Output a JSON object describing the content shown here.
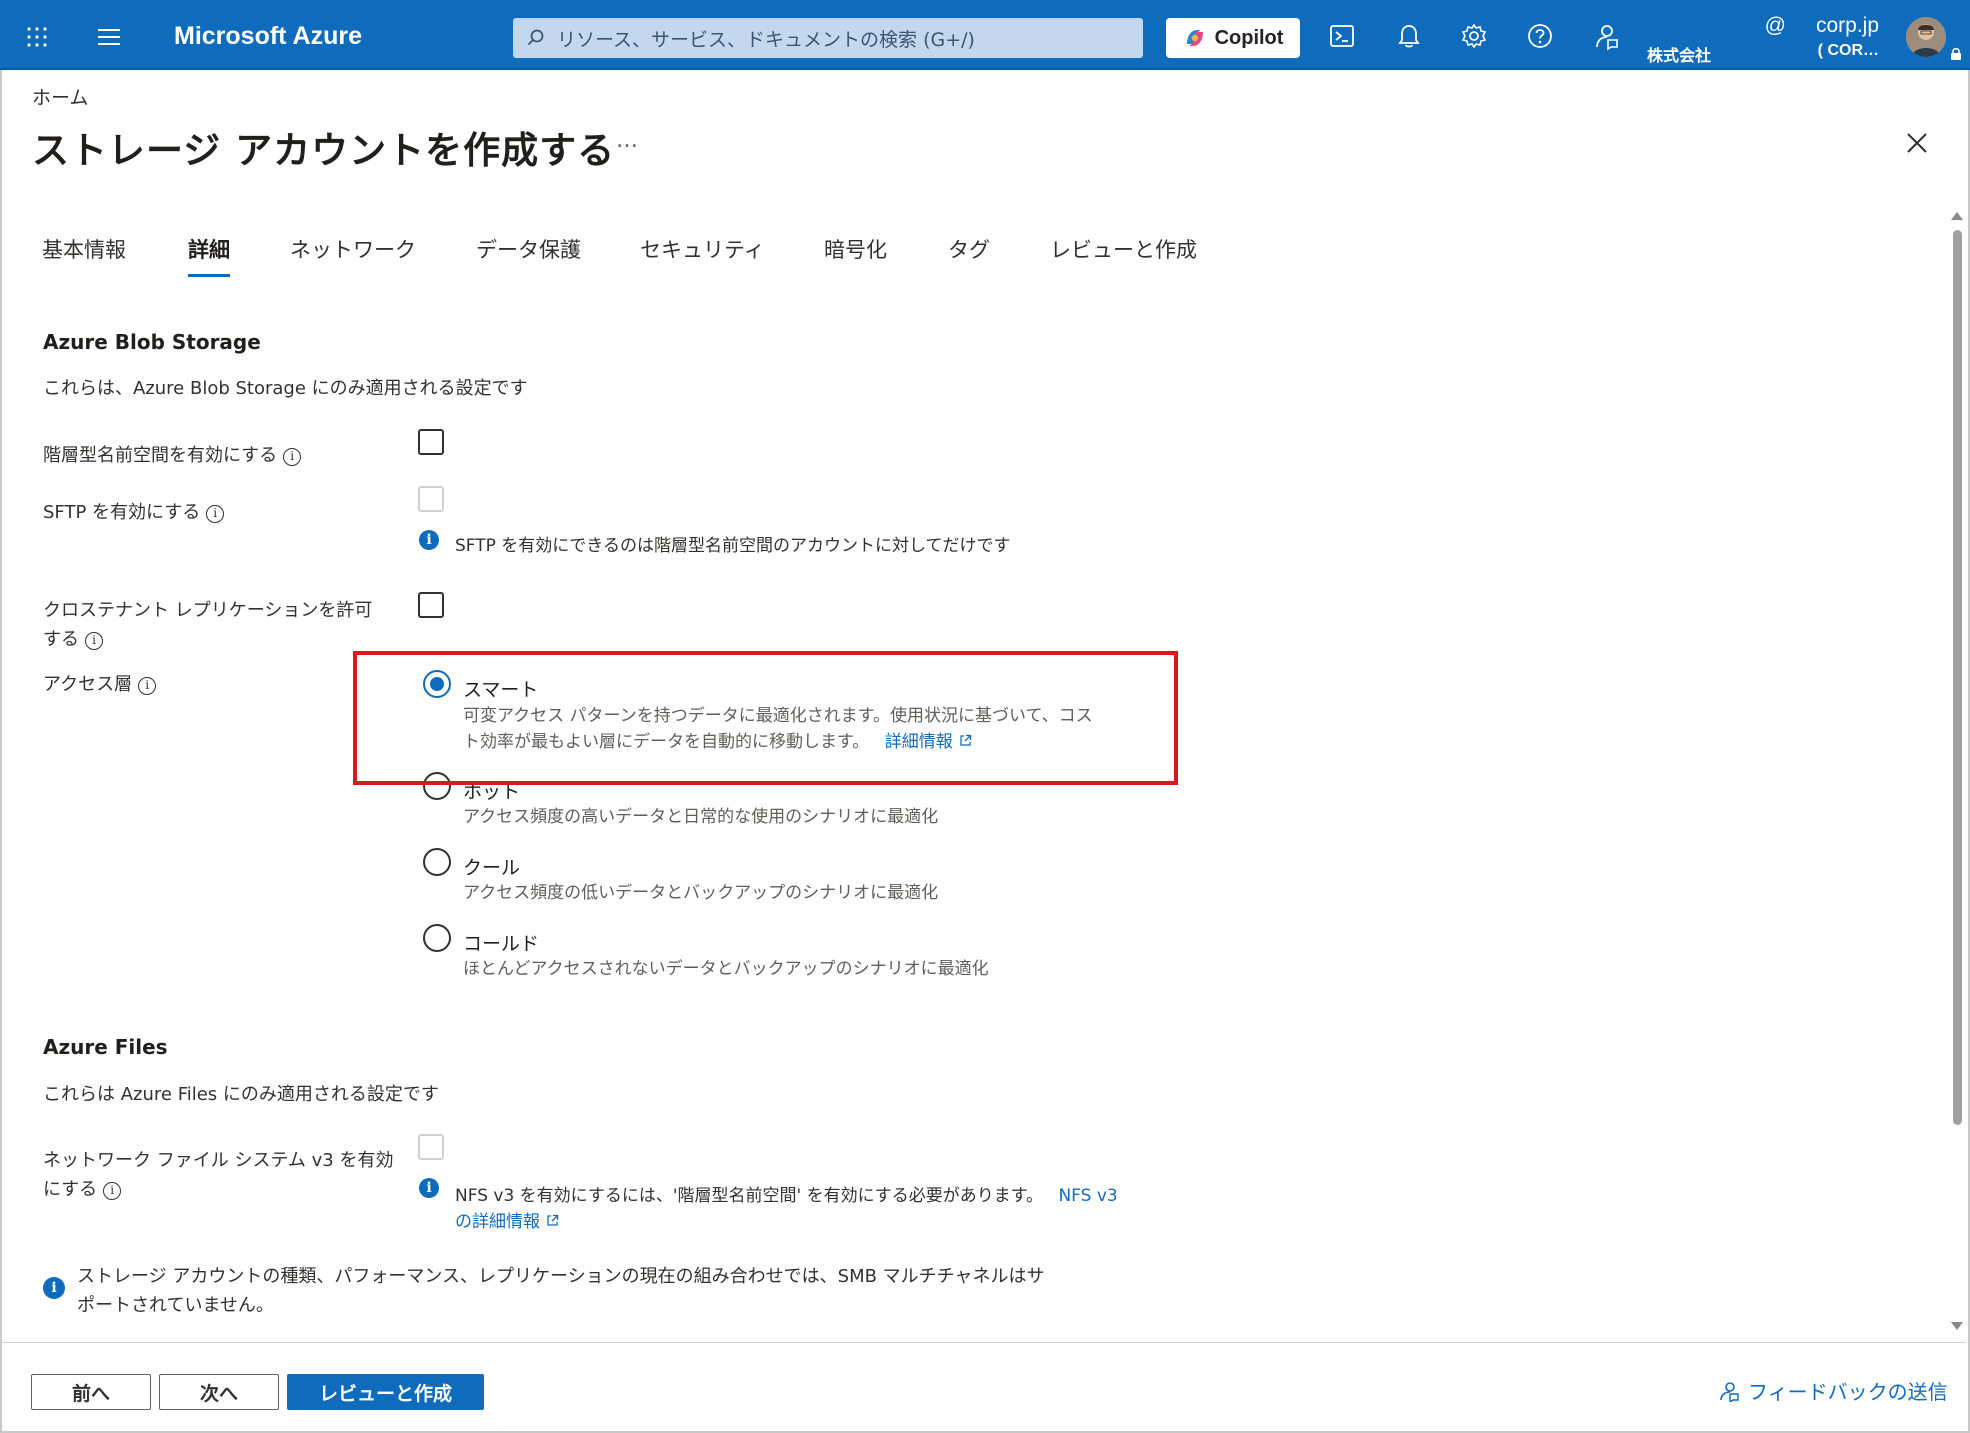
{
  "topbar": {
    "brand": "Microsoft Azure",
    "search_placeholder": "リソース、サービス、ドキュメントの検索 (G+/)",
    "copilot_label": "Copilot",
    "account_domain": "corp.jp",
    "account_at": "@",
    "account_org": "株式会社",
    "account_tenant": "( COR…",
    "icons": [
      "waffle-icon",
      "hamburger-icon",
      "search-icon",
      "copilot-logo",
      "cloud-shell-icon",
      "bell-icon",
      "gear-icon",
      "help-icon",
      "feedback-icon",
      "avatar",
      "lock-icon"
    ]
  },
  "breadcrumb": "ホーム",
  "page": {
    "title": "ストレージ アカウントを作成する",
    "more": "…"
  },
  "tabs": [
    {
      "label": "基本情報",
      "active": false
    },
    {
      "label": "詳細",
      "active": true
    },
    {
      "label": "ネットワーク",
      "active": false
    },
    {
      "label": "データ保護",
      "active": false
    },
    {
      "label": "セキュリティ",
      "active": false
    },
    {
      "label": "暗号化",
      "active": false
    },
    {
      "label": "タグ",
      "active": false
    },
    {
      "label": "レビューと作成",
      "active": false
    }
  ],
  "blob": {
    "title": "Azure Blob Storage",
    "desc": "これらは、Azure Blob Storage にのみ適用される設定です",
    "hns_label": "階層型名前空間を有効にする",
    "hns_checked": false,
    "sftp_label": "SFTP を有効にする",
    "sftp_checked": false,
    "sftp_note": "SFTP を有効にできるのは階層型名前空間のアカウントに対してだけです",
    "cross_tenant_label_1": "クロステナント レプリケーションを許可",
    "cross_tenant_label_2": "する",
    "cross_tenant_checked": false,
    "access_tier_label": "アクセス層",
    "tiers": [
      {
        "label": "スマート",
        "desc_1": "可変アクセス パターンを持つデータに最適化されます。使用状況に基づいて、コス",
        "desc_2": "ト効率が最もよい層にデータを自動的に移動します。",
        "link": "詳細情報",
        "selected": true
      },
      {
        "label": "ホット",
        "desc_1": "アクセス頻度の高いデータと日常的な使用のシナリオに最適化",
        "selected": false
      },
      {
        "label": "クール",
        "desc_1": "アクセス頻度の低いデータとバックアップのシナリオに最適化",
        "selected": false
      },
      {
        "label": "コールド",
        "desc_1": "ほとんどアクセスされないデータとバックアップのシナリオに最適化",
        "selected": false
      }
    ]
  },
  "files": {
    "title": "Azure Files",
    "desc": "これらは Azure Files にのみ適用される設定です",
    "nfs_label_1": "ネットワーク ファイル システム v3 を有効",
    "nfs_label_2": "にする",
    "nfs_checked": false,
    "nfs_note_1": "NFS v3 を有効にするには、'階層型名前空間' を有効にする必要があります。",
    "nfs_link_1": "NFS v3",
    "nfs_link_2": "の詳細情報",
    "smb_note_1": "ストレージ アカウントの種類、パフォーマンス、レプリケーションの現在の組み合わせでは、SMB マルチチャネルはサ",
    "smb_note_2": "ポートされていません。"
  },
  "footer": {
    "prev": "前へ",
    "next": "次へ",
    "review": "レビューと作成",
    "feedback": "フィードバックの送信"
  },
  "colors": {
    "azure_blue": "#0f6cbd",
    "highlight_red": "#d9191c"
  }
}
